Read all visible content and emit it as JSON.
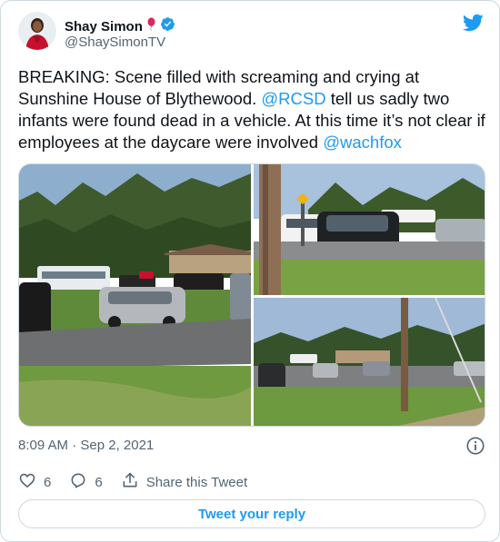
{
  "author": {
    "display_name": "Shay Simon",
    "handle": "@ShaySimonTV",
    "verified": true
  },
  "tweet": {
    "text_parts": [
      {
        "type": "text",
        "value": "BREAKING: Scene filled with screaming and crying at Sunshine House of Blythewood. "
      },
      {
        "type": "mention",
        "value": "@RCSD"
      },
      {
        "type": "text",
        "value": " tell us sadly two infants were found dead in a vehicle. At this time it’s not clear if employees at the daycare were involved "
      },
      {
        "type": "mention",
        "value": "@wachfox"
      }
    ],
    "timestamp": "8:09 AM · Sep 2, 2021"
  },
  "media": {
    "photo_count": 3
  },
  "actions": {
    "like_count": "6",
    "reply_count": "6",
    "share_label": "Share this Tweet"
  },
  "reply_button_label": "Tweet your reply",
  "colors": {
    "accent": "#1d9bf0",
    "text": "#0f1419",
    "muted": "#536471",
    "border": "#cfd9de"
  },
  "icons": [
    "twitter-bird-icon",
    "verified-badge-icon",
    "balloon-emoji-icon",
    "info-icon",
    "heart-icon",
    "reply-icon",
    "share-icon"
  ]
}
